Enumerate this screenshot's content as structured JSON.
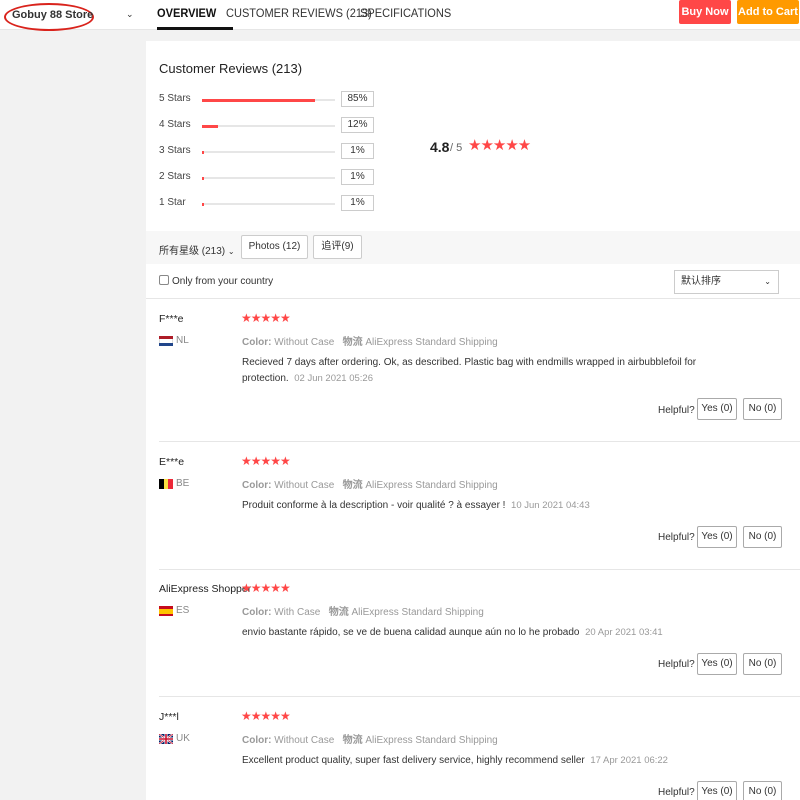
{
  "header": {
    "store_name": "Gobuy 88 Store",
    "tabs": [
      {
        "label": "OVERVIEW",
        "active": true
      },
      {
        "label": "CUSTOMER REVIEWS (213)",
        "active": false
      },
      {
        "label": "SPECIFICATIONS",
        "active": false
      }
    ],
    "buy_now": "Buy Now",
    "add_to_cart": "Add to Cart",
    "colors": {
      "buy_now": "#ff4747",
      "add_to_cart": "#ff9a00"
    }
  },
  "summary": {
    "title": "Customer Reviews (213)",
    "rows": [
      {
        "label": "5 Stars",
        "percent": "85%",
        "fill": 0.85
      },
      {
        "label": "4 Stars",
        "percent": "12%",
        "fill": 0.12
      },
      {
        "label": "3 Stars",
        "percent": "1%",
        "fill": 0.01
      },
      {
        "label": "2 Stars",
        "percent": "1%",
        "fill": 0.01
      },
      {
        "label": "1 Star",
        "percent": "1%",
        "fill": 0.01
      }
    ],
    "average": "4.8",
    "out_of": "/ 5",
    "stars": "★★★★★"
  },
  "filters": {
    "all_ratings": "所有星级 (213)",
    "photos": "Photos (12)",
    "followup": "追评(9)",
    "only_country": "Only from your country",
    "sort": "默认排序"
  },
  "reviews": [
    {
      "name": "F***e",
      "country": "NL",
      "flag": "nl",
      "stars": "★★★★★",
      "color_label": "Color:",
      "color_value": "Without Case",
      "shipping_label": "物流",
      "shipping_value": "AliExpress Standard Shipping",
      "text": "Recieved 7 days after ordering. Ok, as described. Plastic bag with endmills wrapped in airbubblefoil for protection.",
      "date": "02 Jun 2021 05:26",
      "helpful": "Helpful?",
      "yes": "Yes (0)",
      "no": "No (0)"
    },
    {
      "name": "E***e",
      "country": "BE",
      "flag": "be",
      "stars": "★★★★★",
      "color_label": "Color:",
      "color_value": "Without Case",
      "shipping_label": "物流",
      "shipping_value": "AliExpress Standard Shipping",
      "text": "Produit conforme à la description - voir qualité ? à essayer !",
      "date": "10 Jun 2021 04:43",
      "helpful": "Helpful?",
      "yes": "Yes (0)",
      "no": "No (0)"
    },
    {
      "name": "AliExpress Shopper",
      "country": "ES",
      "flag": "es",
      "stars": "★★★★★",
      "color_label": "Color:",
      "color_value": "With Case",
      "shipping_label": "物流",
      "shipping_value": "AliExpress Standard Shipping",
      "text": "envio bastante rápido, se ve de buena calidad aunque aún no lo he probado",
      "date": "20 Apr 2021 03:41",
      "helpful": "Helpful?",
      "yes": "Yes (0)",
      "no": "No (0)"
    },
    {
      "name": "J***l",
      "country": "UK",
      "flag": "uk",
      "stars": "★★★★★",
      "color_label": "Color:",
      "color_value": "Without Case",
      "shipping_label": "物流",
      "shipping_value": "AliExpress Standard Shipping",
      "text": "Excellent product quality, super fast delivery service, highly recommend seller",
      "date": "17 Apr 2021 06:22",
      "helpful": "Helpful?",
      "yes": "Yes (0)",
      "no": "No (0)"
    }
  ]
}
